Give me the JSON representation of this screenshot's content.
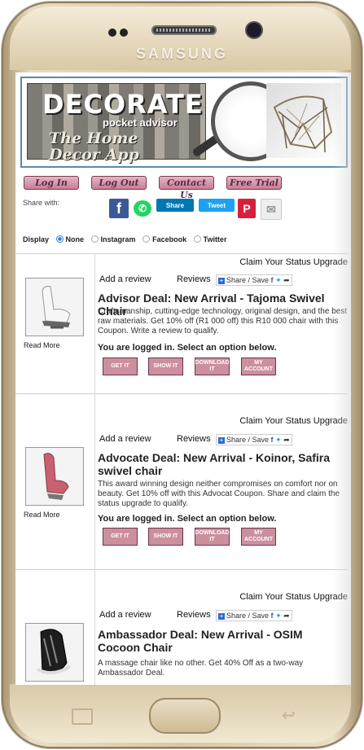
{
  "device": {
    "brand": "SAMSUNG"
  },
  "banner": {
    "title": "DECORATE",
    "subtitle": "pocket advisor",
    "tagline_1": "The Home",
    "tagline_2": "Decor App"
  },
  "nav": {
    "login": "Log In",
    "logout": "Log Out",
    "contact": "Contact Us",
    "trial": "Free Trial"
  },
  "share": {
    "label": "Share with:",
    "linkedin": "Share",
    "twitter": "Tweet"
  },
  "display": {
    "label": "Display",
    "options": [
      "None",
      "Instagram",
      "Facebook",
      "Twitter"
    ],
    "selected": "None"
  },
  "cards": [
    {
      "claim": "Claim Your Status Upgrade",
      "add_review": "Add a review",
      "reviews": "Reviews",
      "share_save": "Share / Save",
      "title": "Advisor Deal: New Arrival - Tajoma Swivel Chair",
      "desc": "Craftsmanship, cutting-edge technology, original design, and the best raw materials. Get 10% off (R1 000 off) this R10 000 chair with this Coupon. Write a review to qualify.",
      "logged": "You are logged in. Select an option below.",
      "read_more": "Read More",
      "buttons": [
        "GET IT",
        "SHOW IT",
        "DOWNLOAD IT",
        "MY ACCOUNT"
      ]
    },
    {
      "claim": "Claim Your Status Upgrade",
      "add_review": "Add a review",
      "reviews": "Reviews",
      "share_save": "Share / Save",
      "title": "Advocate Deal: New Arrival - Koinor, Safira swivel chair",
      "desc": "This award winning design neither compromises on comfort nor on beauty. Get 10% off with this Advocat Coupon. Share and claim the status upgrade to qualify.",
      "logged": "You are logged in. Select an option below.",
      "read_more": "Read More",
      "buttons": [
        "GET IT",
        "SHOW IT",
        "DOWNLOAD IT",
        "MY ACCOUNT"
      ]
    },
    {
      "claim": "Claim Your Status Upgrade",
      "add_review": "Add a review",
      "reviews": "Reviews",
      "share_save": "Share / Save",
      "title": "Ambassador Deal: New Arrival - OSIM Cocoon Chair",
      "desc": "A massage chair like no other. Get 40% Off as a two-way Ambassador Deal."
    }
  ],
  "colors": {
    "button_pink": "#cc8f9e",
    "radio_blue": "#2e7bd4",
    "share_blue": "#2a6ad2"
  }
}
